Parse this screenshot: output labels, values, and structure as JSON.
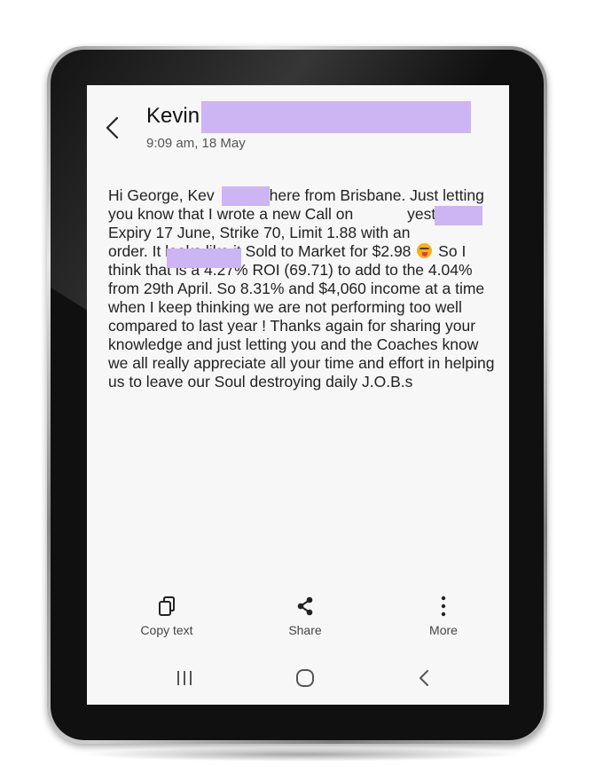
{
  "header": {
    "contact_name": "Kevin",
    "timestamp": "9:09 am, 18 May"
  },
  "message": {
    "seg1": "Hi George, Kev",
    "seg2": "here from Brisbane. Just letting you know that I wrote a new Call on",
    "seg3": "yesterday. Expiry 17 June, Strike 70, Limit 1.88 with an",
    "seg4": "order. It looks like it Sold to Market for $2.98",
    "seg5": "So I think that is a 4.27% ROI (69.71) to add to the 4.04% from 29th April. So 8.31% and $4,060 income at a time when I keep thinking we are not performing too well compared to last year ! Thanks again for sharing your knowledge and just letting you and the Coaches know we all really appreciate all your time and effort in helping us to leave our Soul destroying daily J.O.B.s"
  },
  "actions": {
    "copy_label": "Copy text",
    "share_label": "Share",
    "more_label": "More"
  },
  "icons": {
    "back": "chevron-left-icon",
    "copy": "copy-icon",
    "share": "share-icon",
    "more": "more-vertical-icon",
    "recents": "recent-apps-icon",
    "home": "home-icon",
    "nav_back": "nav-back-icon",
    "emoji": "winking-tongue-emoji"
  },
  "colors": {
    "redaction": "#cdb4f2",
    "screen_bg": "#f7f7f7"
  }
}
